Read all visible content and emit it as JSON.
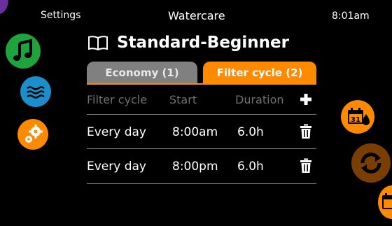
{
  "topbar": {
    "left": "Settings",
    "center": "Watercare",
    "time": "8:01am"
  },
  "title": {
    "text": "Standard-Beginner",
    "icon": "book-icon"
  },
  "tabs": [
    {
      "label": "Economy (1)",
      "active": false
    },
    {
      "label": "Filter cycle (2)",
      "active": true
    }
  ],
  "table": {
    "headers": {
      "cycle": "Filter cycle",
      "start": "Start",
      "duration": "Duration"
    },
    "rows": [
      {
        "cycle": "Every day",
        "start": "8:00am",
        "duration": "6.0h"
      },
      {
        "cycle": "Every day",
        "start": "8:00pm",
        "duration": "6.0h"
      }
    ]
  },
  "calendar_icon": {
    "day": "31"
  },
  "colors": {
    "accent": "#ff8a00",
    "tab_inactive": "#808080",
    "music": "#1fa33c",
    "water": "#1b8fcc",
    "background": "#000000"
  },
  "icons": {
    "left": [
      "music-note-icon",
      "water-waves-icon",
      "gears-icon"
    ],
    "right": [
      "calendar-drop-icon",
      "cycle-arrows-icon",
      "calendar-partial-icon"
    ],
    "actions": [
      "plus-icon",
      "trash-icon"
    ]
  }
}
